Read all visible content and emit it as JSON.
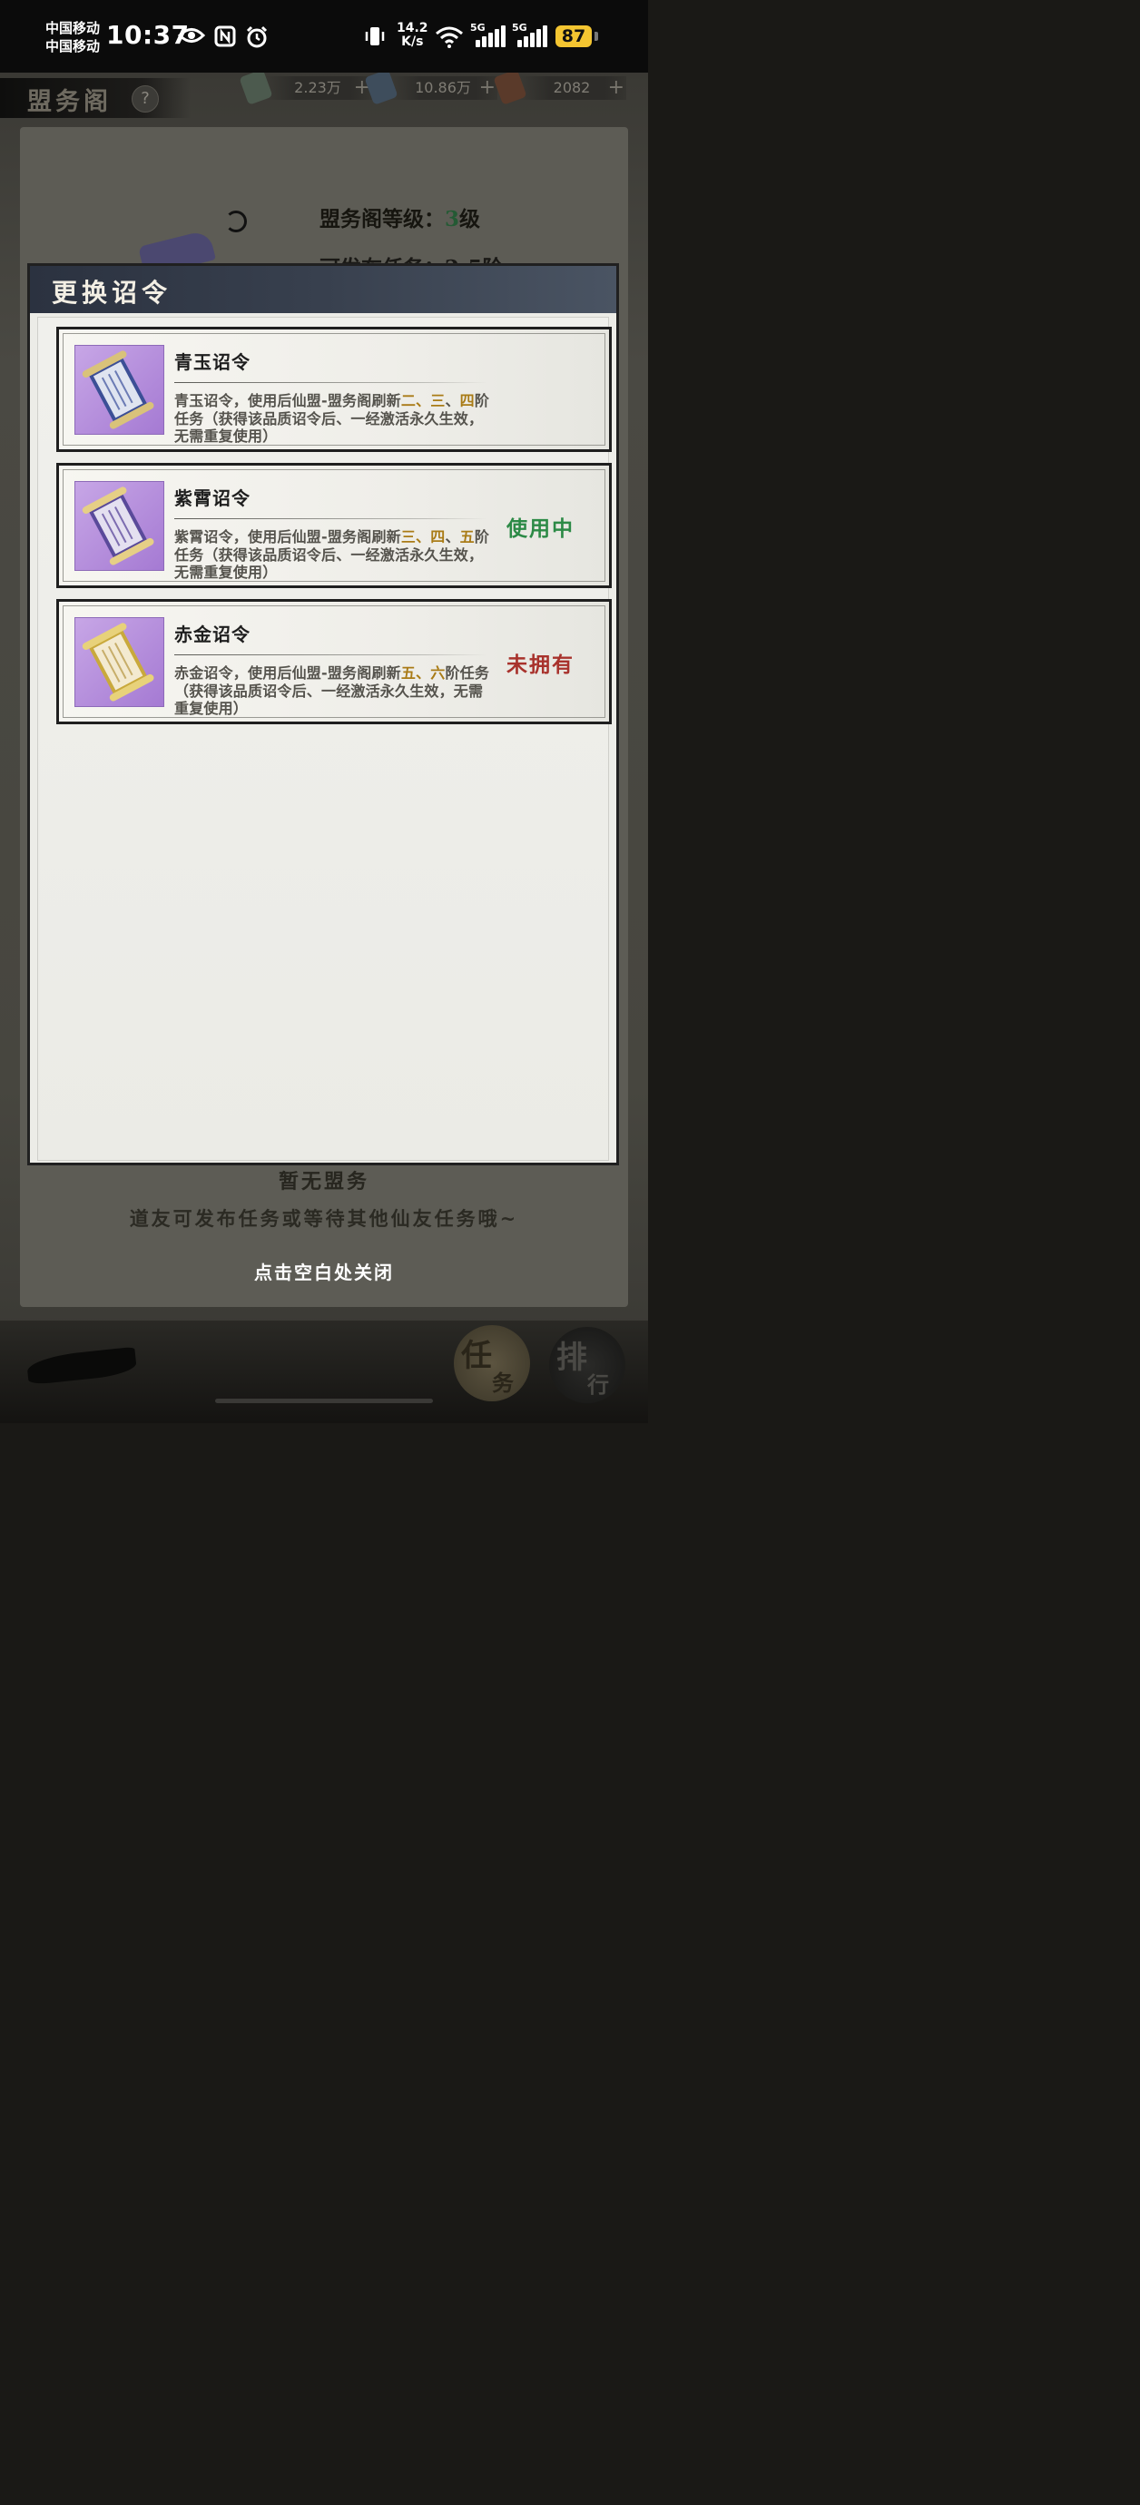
{
  "status_bar": {
    "carrier_1": "中国移动",
    "carrier_2": "中国移动",
    "time": "10:37",
    "net_speed_value": "14.2",
    "net_speed_unit": "K/s",
    "battery": "87",
    "icons": [
      "eye-icon",
      "nfc-icon",
      "alarm-icon",
      "vibrate-icon",
      "wifi-icon",
      "signal-5g-icon",
      "signal-5g-icon"
    ]
  },
  "header": {
    "title": "盟务阁",
    "help": "?"
  },
  "currencies": [
    {
      "value": "2.23万",
      "plus": "+",
      "icon": "jade-icon"
    },
    {
      "value": "10.86万",
      "plus": "+",
      "icon": "gourd-icon"
    },
    {
      "value": "2082",
      "plus": "+",
      "icon": "scroll-icon"
    }
  ],
  "background_panel": {
    "level_label": "盟务阁等级：",
    "level_value": "3",
    "level_unit": "级",
    "sub_text": "可发布任务：2-5阶",
    "empty_title": "暂无盟务",
    "empty_hint": "道友可发布任务或等待其他仙友任务哦~"
  },
  "modal": {
    "title": "更换诏令",
    "items": [
      {
        "name": "青玉诏令",
        "desc_before": "青玉诏令，使用后仙盟-盟务阁刷新",
        "hl_1": "二、三",
        "sep": "、",
        "hl_2": "四",
        "desc_after": "阶任务（获得该品质诏令后、一经激活永久生效，无需重复使用）",
        "status": "",
        "icon": "blue-scroll-icon"
      },
      {
        "name": "紫霄诏令",
        "desc_before": "紫霄诏令，使用后仙盟-盟务阁刷新",
        "hl_1": "三、四",
        "sep": "、",
        "hl_2": "五",
        "desc_after": "阶任务（获得该品质诏令后、一经激活永久生效，无需重复使用）",
        "status": "使用中",
        "status_color": "#2c8a46",
        "icon": "purple-scroll-icon"
      },
      {
        "name": "赤金诏令",
        "desc_before": "赤金诏令，使用后仙盟-盟务阁刷新",
        "hl_1": "五、六",
        "sep": "",
        "hl_2": "",
        "desc_after": "阶任务（获得该品质诏令后、一经激活永久生效，无需重复使用）",
        "status": "未拥有",
        "status_color": "#a8322c",
        "icon": "gold-scroll-icon"
      }
    ]
  },
  "close_hint": "点击空白处关闭",
  "bottom_buttons": {
    "task_1": "任",
    "task_2": "务",
    "rank_1": "排",
    "rank_2": "行"
  }
}
